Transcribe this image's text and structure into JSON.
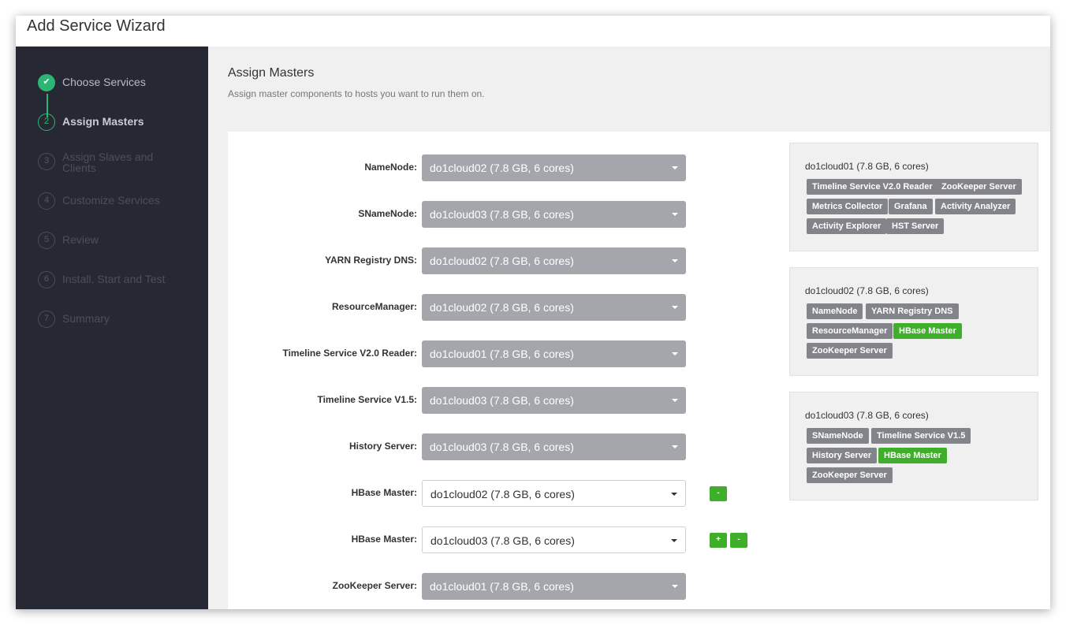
{
  "wizard": {
    "title": "Add Service Wizard"
  },
  "steps": [
    {
      "marker": "✔",
      "label": "Choose Services"
    },
    {
      "marker": "2",
      "label": "Assign Masters"
    },
    {
      "marker": "3",
      "label": "Assign Slaves and Clients"
    },
    {
      "marker": "4",
      "label": "Customize Services"
    },
    {
      "marker": "5",
      "label": "Review"
    },
    {
      "marker": "6",
      "label": "Install, Start and Test"
    },
    {
      "marker": "7",
      "label": "Summary"
    }
  ],
  "page": {
    "title": "Assign Masters",
    "description": "Assign master components to hosts you want to run them on."
  },
  "assignments": [
    {
      "label": "NameNode:",
      "value": "do1cloud02 (7.8 GB, 6 cores)"
    },
    {
      "label": "SNameNode:",
      "value": "do1cloud03 (7.8 GB, 6 cores)"
    },
    {
      "label": "YARN Registry DNS:",
      "value": "do1cloud02 (7.8 GB, 6 cores)"
    },
    {
      "label": "ResourceManager:",
      "value": "do1cloud02 (7.8 GB, 6 cores)"
    },
    {
      "label": "Timeline Service V2.0 Reader:",
      "value": "do1cloud01 (7.8 GB, 6 cores)"
    },
    {
      "label": "Timeline Service V1.5:",
      "value": "do1cloud03 (7.8 GB, 6 cores)"
    },
    {
      "label": "History Server:",
      "value": "do1cloud03 (7.8 GB, 6 cores)"
    },
    {
      "label": "HBase Master:",
      "value": "do1cloud02 (7.8 GB, 6 cores)"
    },
    {
      "label": "HBase Master:",
      "value": "do1cloud03 (7.8 GB, 6 cores)"
    },
    {
      "label": "ZooKeeper Server:",
      "value": "do1cloud01 (7.8 GB, 6 cores)"
    }
  ],
  "buttons": {
    "add": "+",
    "remove": "-"
  },
  "hosts": [
    {
      "name": "do1cloud01 (7.8 GB, 6 cores)",
      "components": [
        "Timeline Service V2.0 Reader",
        "ZooKeeper Server",
        "Metrics Collector",
        "Grafana",
        "Activity Analyzer",
        "Activity Explorer",
        "HST Server"
      ]
    },
    {
      "name": "do1cloud02 (7.8 GB, 6 cores)",
      "components": [
        "NameNode",
        "YARN Registry DNS",
        "ResourceManager",
        "HBase Master",
        "ZooKeeper Server"
      ]
    },
    {
      "name": "do1cloud03 (7.8 GB, 6 cores)",
      "components": [
        "SNameNode",
        "Timeline Service V1.5",
        "History Server",
        "HBase Master",
        "ZooKeeper Server"
      ]
    }
  ],
  "colors": {
    "sidebar": "#262933",
    "accent_green": "#2bb673",
    "new_component": "#3fae2a",
    "tag_gray": "#82848a"
  }
}
